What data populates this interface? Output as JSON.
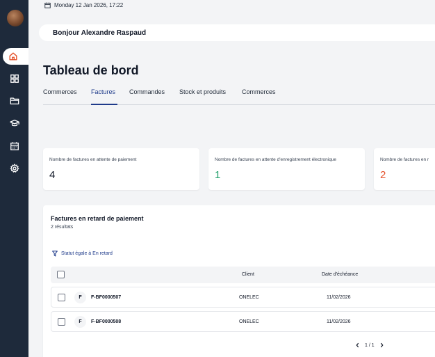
{
  "topbar": {
    "datetime": "Monday 12 Jan 2026, 17:22"
  },
  "greeting": "Bonjour Alexandre Raspaud",
  "page_title": "Tableau de bord",
  "tabs": [
    {
      "label": "Commerces",
      "active": false
    },
    {
      "label": "Factures",
      "active": true
    },
    {
      "label": "Commandes",
      "active": false
    },
    {
      "label": "Stock et produits",
      "active": false
    },
    {
      "label": "Commerces",
      "active": false
    }
  ],
  "sidebar": {
    "items": [
      {
        "icon": "home-icon",
        "active": true
      },
      {
        "icon": "dashboard-grid-icon",
        "active": false
      },
      {
        "icon": "folder-icon",
        "active": false
      },
      {
        "icon": "graduation-cap-icon",
        "active": false
      },
      {
        "icon": "calendar-icon",
        "active": false
      },
      {
        "icon": "gear-icon",
        "active": false
      }
    ]
  },
  "cards": [
    {
      "label": "Nombre de factures en attente de paiement",
      "value": "4",
      "color": "#111827"
    },
    {
      "label": "Nombre de factures en attente d'enregistrement électronique",
      "value": "1",
      "color": "#22a06b"
    },
    {
      "label": "Nombre de factures en r",
      "value": "2",
      "color": "#e5532d"
    }
  ],
  "late_invoices": {
    "title": "Factures en retard de paiement",
    "count": "2 résultats",
    "filter_label": "Statut égale à En retard",
    "columns": {
      "client": "Client",
      "due_date": "Date d'échéance"
    },
    "rows": [
      {
        "initial": "F",
        "number": "F-BF0000507",
        "client": "ONELEC",
        "due_date": "11/02/2026"
      },
      {
        "initial": "F",
        "number": "F-BF0000508",
        "client": "ONELEC",
        "due_date": "11/02/2026"
      }
    ],
    "pagination": "1 / 1"
  },
  "colors": {
    "sidebar": "#1e2a3b",
    "accent": "#1e3a8a",
    "home_icon": "#e5532d"
  }
}
